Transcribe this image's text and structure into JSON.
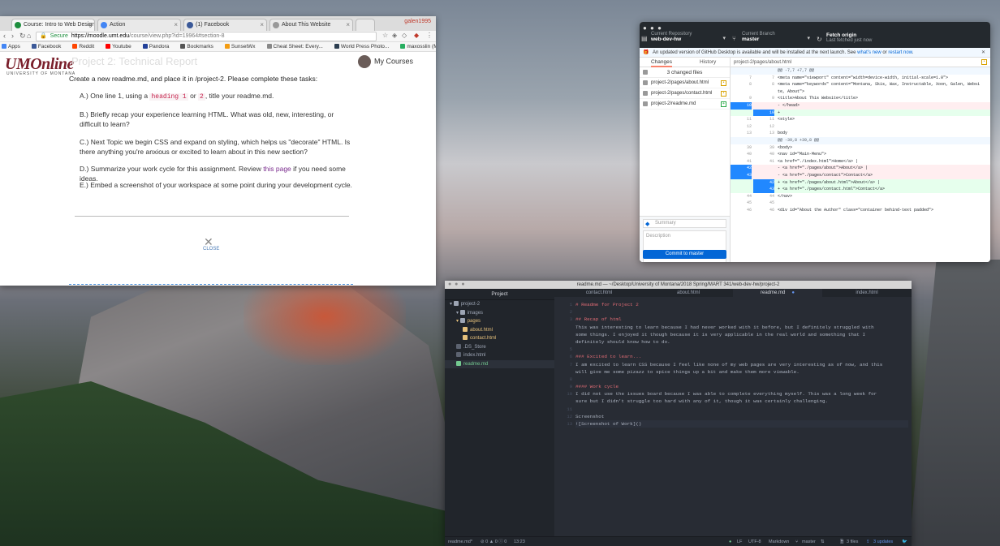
{
  "chrome": {
    "tabs": [
      {
        "label": "Course: Intro to Web Design",
        "active": true,
        "color": "#1e8e3e"
      },
      {
        "label": "Action",
        "active": false,
        "color": "#4285f4"
      },
      {
        "label": "(1) Facebook",
        "active": false,
        "color": "#3b5998"
      },
      {
        "label": "About This Website",
        "active": false,
        "color": "#999999"
      }
    ],
    "profile": "galen1995",
    "secure_label": "Secure",
    "url_host": "https://moodle.umt.edu",
    "url_path": "/course/view.php?id=19964#section-8",
    "bookmarks": [
      {
        "label": "Apps",
        "color": "#4285f4"
      },
      {
        "label": "Facebook",
        "color": "#3b5998"
      },
      {
        "label": "Reddit",
        "color": "#ff4500"
      },
      {
        "label": "Youtube",
        "color": "#ff0000"
      },
      {
        "label": "Pandora",
        "color": "#224099"
      },
      {
        "label": "Bookmarks",
        "color": "#555555"
      },
      {
        "label": "SunsetWx",
        "color": "#f39c12"
      },
      {
        "label": "Cheat Sheet: Every...",
        "color": "#888888"
      },
      {
        "label": "World Press Photo...",
        "color": "#2c3e50"
      },
      {
        "label": "maxosslin (Max As...",
        "color": "#27ae60"
      }
    ]
  },
  "moodle": {
    "logo": "UMOnline",
    "logo_sub": "UNIVERSITY OF MONTANA",
    "ghost_title": "Project 2: Technical Report",
    "my_courses": "My Courses",
    "intro": "Create a new readme.md, and place it in /project-2. Please complete these tasks:",
    "task_a_pre": "A.) One line 1, using a",
    "task_a_code1": "heading 1",
    "task_a_mid": "or",
    "task_a_code2": "2",
    "task_a_post": ", title your readme.md.",
    "task_b": "B.) Briefly recap your experience learning HTML. What was old, new, interesting, or difficult to learn?",
    "task_c": "C.) Next Topic we begin CSS and expand on styling, which helps us \"decorate\" HTML. Is there anything you're anxious or excited to learn about in this new section?",
    "task_d_pre": "D.) Summarize your work cycle for this assignment. Review",
    "task_d_link": "this page",
    "task_d_post": "if you need some ideas.",
    "task_e": "E.) Embed a screenshot of your workspace at some point during your development cycle.",
    "close_label": "CLOSE"
  },
  "github": {
    "repo_label": "Current Repository",
    "repo": "web-dev-hw",
    "branch_label": "Current Branch",
    "branch": "master",
    "fetch_label": "Fetch origin",
    "fetch_sub": "Last fetched just now",
    "banner_text": "An updated version of GitHub Desktop is available and will be installed at the next launch. See",
    "banner_link1": "what's new",
    "banner_or": "or",
    "banner_link2": "restart now",
    "tab_changes": "Changes",
    "tab_history": "History",
    "diff_path": "project-2/pages/about.html",
    "changed_files": "3 changed files",
    "files": [
      {
        "name": "project-2/pages/about.html",
        "status": "modified"
      },
      {
        "name": "project-2/pages/contact.html",
        "status": "modified"
      },
      {
        "name": "project-2/readme.md",
        "status": "new"
      }
    ],
    "summary_placeholder": "Summary",
    "description_placeholder": "Description",
    "commit_button": "Commit to master",
    "diff_lines": [
      {
        "type": "hunk",
        "o": "",
        "n": "",
        "text": "@@ -7,7 +7,7 @@"
      },
      {
        "type": "ctx",
        "o": "7",
        "n": "7",
        "text": "    <meta name=\"viewport\" content=\"width=device-width, initial-scale=1.0\">"
      },
      {
        "type": "ctx",
        "o": "8",
        "n": "8",
        "text": "    <meta name=\"keywords\" content=\"Montana, Skis, Wax, Instructable, Xoon, Galen, Websi"
      },
      {
        "type": "ctx",
        "o": "",
        "n": "",
        "text": "te, About\">"
      },
      {
        "type": "ctx",
        "o": "9",
        "n": "9",
        "text": "    <title>About This Website</title>"
      },
      {
        "type": "del",
        "o": "10",
        "n": "",
        "text": "- </head>"
      },
      {
        "type": "add",
        "o": "",
        "n": "10",
        "text": "+ "
      },
      {
        "type": "ctx",
        "o": "11",
        "n": "11",
        "text": "  <style>"
      },
      {
        "type": "ctx",
        "o": "12",
        "n": "12",
        "text": ""
      },
      {
        "type": "ctx",
        "o": "13",
        "n": "13",
        "text": "  body"
      },
      {
        "type": "hunk",
        "o": "",
        "n": "",
        "text": "@@ -39,8 +39,8 @@"
      },
      {
        "type": "ctx",
        "o": "39",
        "n": "39",
        "text": "  <body>"
      },
      {
        "type": "ctx",
        "o": "40",
        "n": "40",
        "text": "  <nav id=\"Main-Menu\">"
      },
      {
        "type": "ctx",
        "o": "41",
        "n": "41",
        "text": "    <a href=\"./index.html\">Home</a> |"
      },
      {
        "type": "del",
        "o": "42",
        "n": "",
        "text": "-   <a href=\"./pages/about\">About</a> |"
      },
      {
        "type": "del",
        "o": "43",
        "n": "",
        "text": "-   <a href=\"./pages/contact\">Contact</a>"
      },
      {
        "type": "add",
        "o": "",
        "n": "42",
        "text": "+   <a href=\"./pages/about.html\">About</a> |"
      },
      {
        "type": "add",
        "o": "",
        "n": "43",
        "text": "+   <a href=\"./pages/contact.html\">Contact</a>"
      },
      {
        "type": "ctx",
        "o": "44",
        "n": "44",
        "text": "  </nav>"
      },
      {
        "type": "ctx",
        "o": "45",
        "n": "45",
        "text": ""
      },
      {
        "type": "ctx",
        "o": "46",
        "n": "46",
        "text": "  <div id=\"About the Author\" class=\"container behind-text padded\">"
      }
    ]
  },
  "atom": {
    "title": "readme.md — ~/Desktop/University of Montana/2018 Spring/MART 341/web-dev-hw/project-2",
    "project_label": "Project",
    "tabs": [
      {
        "label": "contact.html",
        "active": false
      },
      {
        "label": "about.html",
        "active": false
      },
      {
        "label": "readme.md",
        "active": true
      },
      {
        "label": "index.html",
        "active": false
      }
    ],
    "tree": [
      {
        "label": "project-2",
        "indent": 0,
        "kind": "folder",
        "state": ""
      },
      {
        "label": "images",
        "indent": 1,
        "kind": "folder",
        "state": ""
      },
      {
        "label": "pages",
        "indent": 1,
        "kind": "folder",
        "state": "modified"
      },
      {
        "label": "about.html",
        "indent": 2,
        "kind": "file",
        "state": "modified"
      },
      {
        "label": "contact.html",
        "indent": 2,
        "kind": "file",
        "state": "modified"
      },
      {
        "label": ".DS_Store",
        "indent": 1,
        "kind": "file",
        "state": ""
      },
      {
        "label": "index.html",
        "indent": 1,
        "kind": "file",
        "state": ""
      },
      {
        "label": "readme.md",
        "indent": 1,
        "kind": "file",
        "state": "added"
      }
    ],
    "lines": [
      {
        "n": "1",
        "text": "# Readme for Project 2",
        "style": "h"
      },
      {
        "n": "2",
        "text": "",
        "style": ""
      },
      {
        "n": "3",
        "text": "## Recap of html",
        "style": "h"
      },
      {
        "n": "",
        "text": "This was interesting to learn because I had never worked with it before, but I definitely struggled with",
        "style": ""
      },
      {
        "n": "",
        "text": "some things. I enjoyed it though because it is very applicable in the real world and something that I",
        "style": ""
      },
      {
        "n": "",
        "text": "definitely should know how to do.",
        "style": ""
      },
      {
        "n": "5",
        "text": "",
        "style": ""
      },
      {
        "n": "6",
        "text": "### Excited to learn...",
        "style": "h"
      },
      {
        "n": "7",
        "text": "I am excited to learn CSS because I feel like none of my web pages are very interesting as of now, and this",
        "style": ""
      },
      {
        "n": "",
        "text": "will give me some pizazz to spice things up a bit and make them more viewable.",
        "style": ""
      },
      {
        "n": "8",
        "text": "",
        "style": ""
      },
      {
        "n": "9",
        "text": "#### Work cycle",
        "style": "h"
      },
      {
        "n": "10",
        "text": "I did not use the issues board because I was able to complete everything myself. This was a long week for",
        "style": ""
      },
      {
        "n": "",
        "text": "sure but I didn't struggle too hard with any of it, though it was certainly challenging.",
        "style": ""
      },
      {
        "n": "11",
        "text": "",
        "style": ""
      },
      {
        "n": "12",
        "text": "Screenshot",
        "style": ""
      },
      {
        "n": "13",
        "text": "![Screenshot of Work]()",
        "style": "cur"
      }
    ],
    "status": {
      "file": "readme.md*",
      "diagnostics": "⊘ 0 ▲ 0 ⓘ 0",
      "cursor": "13:23",
      "eol": "LF",
      "encoding": "UTF-8",
      "grammar": "Markdown",
      "branch": "master",
      "files": "3 files",
      "updates": "3 updates"
    }
  }
}
